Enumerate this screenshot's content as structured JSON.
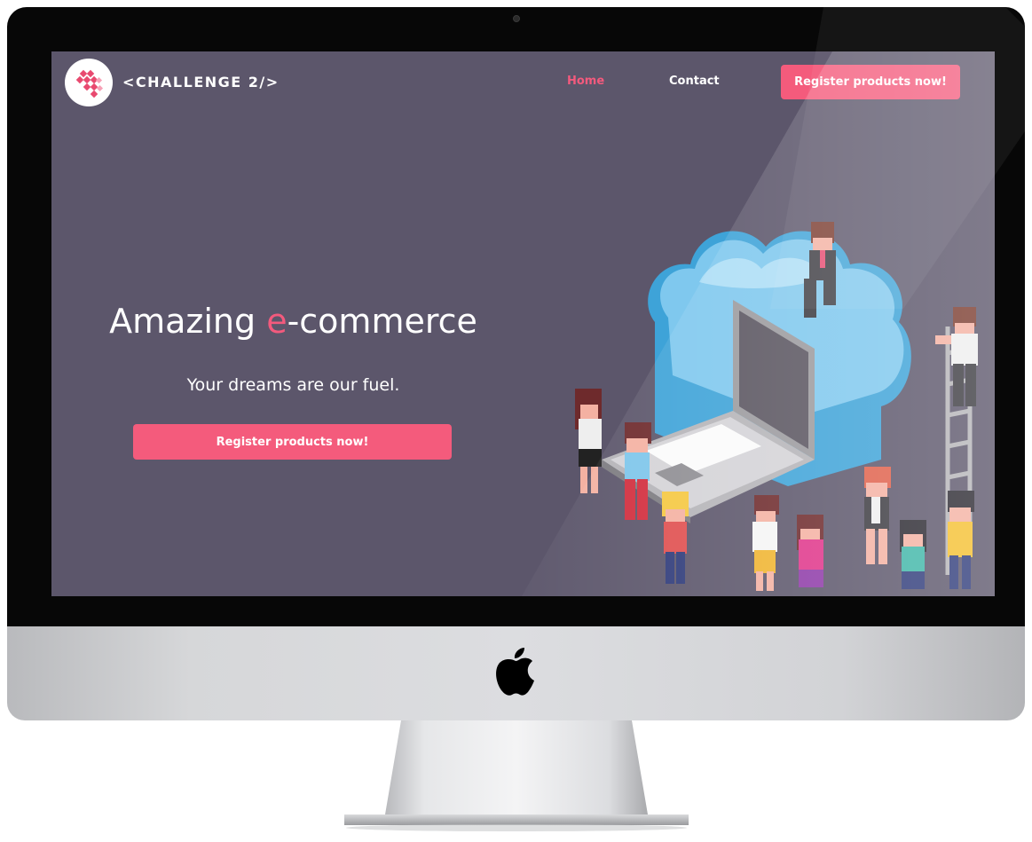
{
  "nav": {
    "logo_text": "<CHALLENGE 2/>",
    "home_label": "Home",
    "contact_label": "Contact",
    "cta_label": "Register products now!"
  },
  "hero": {
    "title_part1": "Amazing ",
    "title_accent": "e",
    "title_part2": "-commerce",
    "subtitle": "Your dreams are our fuel.",
    "cta_label": "Register products now!"
  },
  "colors": {
    "background": "#5c566b",
    "accent": "#f45b7c",
    "text": "#ffffff"
  },
  "icons": {
    "logo": "pink-pixel-heart-logo",
    "illustration": "isometric-cloud-laptop-people",
    "device_brand": "apple-icon"
  }
}
